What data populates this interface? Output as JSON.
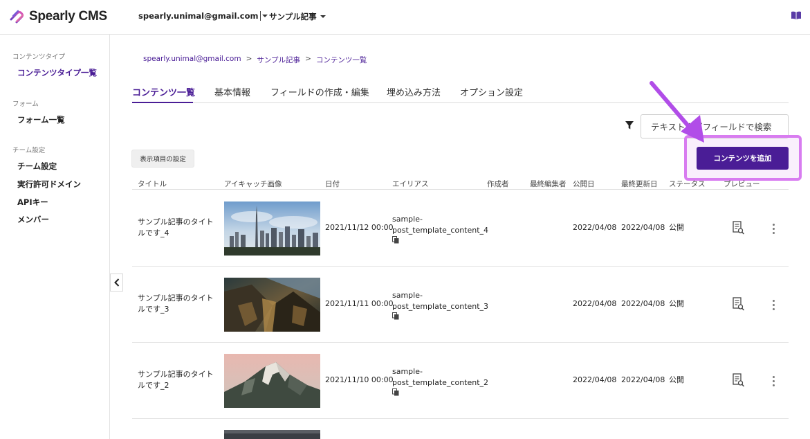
{
  "header": {
    "logo_text": "Spearly CMS",
    "account": "spearly.unimal@gmail.com",
    "project": "サンプル記事"
  },
  "sidebar": {
    "sections": [
      {
        "label": "コンテンツタイプ",
        "items": [
          {
            "label": "コンテンツタイプ一覧",
            "active": true
          }
        ]
      },
      {
        "label": "フォーム",
        "items": [
          {
            "label": "フォーム一覧"
          }
        ]
      },
      {
        "label": "チーム設定",
        "items": [
          {
            "label": "チーム設定"
          },
          {
            "label": "実行許可ドメイン"
          },
          {
            "label": "APIキー"
          },
          {
            "label": "メンバー"
          }
        ]
      }
    ]
  },
  "breadcrumb": [
    "spearly.unimal@gmail.com",
    "サンプル記事",
    "コンテンツ一覧"
  ],
  "breadcrumb_sep": ">",
  "tabs": [
    "コンテンツ一覧",
    "基本情報",
    "フィールドの作成・編集",
    "埋め込み方法",
    "オプション設定"
  ],
  "search": {
    "placeholder": "テキストタグフィールドで検索"
  },
  "buttons": {
    "display_settings": "表示項目の設定",
    "add_content": "コンテンツを追加"
  },
  "table": {
    "columns": [
      "タイトル",
      "アイキャッチ画像",
      "日付",
      "エイリアス",
      "作成者",
      "最終編集者",
      "公開日",
      "最終更新日",
      "ステータス",
      "プレビュー"
    ],
    "rows": [
      {
        "title_1": "サンプル記事のタイト",
        "title_2": "ルです_4",
        "image": "city-skyline",
        "date": "2021/11/12 00:00",
        "alias_1": "sample-",
        "alias_2": "post_template_content_4",
        "published": "2022/04/08",
        "updated": "2022/04/08",
        "status": "公開"
      },
      {
        "title_1": "サンプル記事のタイト",
        "title_2": "ルです_3",
        "image": "canyon",
        "date": "2021/11/11 00:00",
        "alias_1": "sample-",
        "alias_2": "post_template_content_3",
        "published": "2022/04/08",
        "updated": "2022/04/08",
        "status": "公開"
      },
      {
        "title_1": "サンプル記事のタイト",
        "title_2": "ルです_2",
        "image": "mountain",
        "date": "2021/11/10 00:00",
        "alias_1": "sample-",
        "alias_2": "post_template_content_2",
        "published": "2022/04/08",
        "updated": "2022/04/08",
        "status": "公開"
      }
    ]
  },
  "colors": {
    "brand": "#4a1d96",
    "highlight": "#d87cf0",
    "arrow": "#b14de8"
  }
}
